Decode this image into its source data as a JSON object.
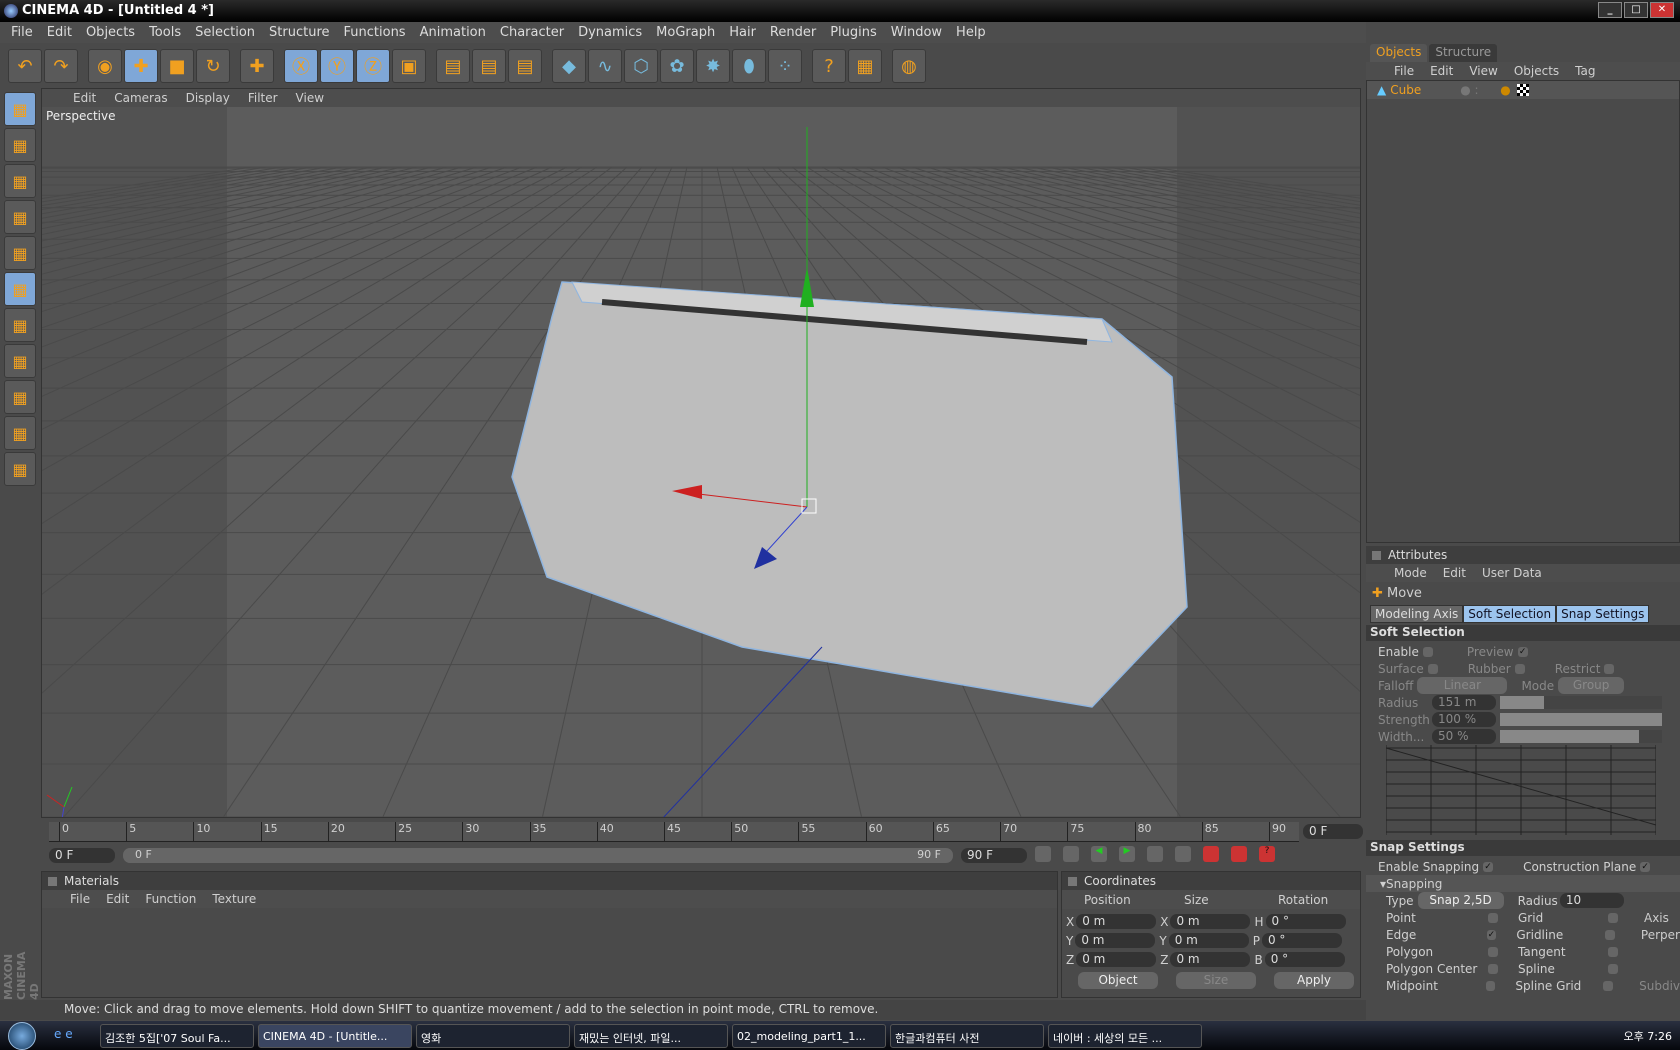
{
  "window": {
    "title": "CINEMA 4D - [Untitled 4 *]"
  },
  "menu": [
    "File",
    "Edit",
    "Objects",
    "Tools",
    "Selection",
    "Structure",
    "Functions",
    "Animation",
    "Character",
    "Dynamics",
    "MoGraph",
    "Hair",
    "Render",
    "Plugins",
    "Window",
    "Help"
  ],
  "toolbar": {
    "icons": [
      "undo-icon",
      "redo-icon",
      "live-selection-icon",
      "move-icon",
      "scale-icon",
      "rotate-icon",
      "add-icon",
      "x-axis-icon",
      "y-axis-icon",
      "z-axis-icon",
      "coordinate-system-icon",
      "render-view-icon",
      "render-picture-viewer-icon",
      "render-settings-icon",
      "cube-primitive-icon",
      "spline-icon",
      "nurbs-icon",
      "array-icon",
      "deformer-icon",
      "scene-icon",
      "particle-icon",
      "help-icon",
      "timeline-icon",
      "browser-icon"
    ]
  },
  "viewport": {
    "menu": [
      "Edit",
      "Cameras",
      "Display",
      "Filter",
      "View"
    ],
    "label": "Perspective"
  },
  "timeline": {
    "ticks": [
      "0",
      "5",
      "10",
      "15",
      "20",
      "25",
      "30",
      "35",
      "40",
      "45",
      "50",
      "55",
      "60",
      "65",
      "70",
      "75",
      "80",
      "85",
      "90"
    ],
    "current_frame": "0 F",
    "start": "0 F",
    "slider_start": "0 F",
    "slider_end": "90 F",
    "end": "90 F"
  },
  "materials": {
    "title": "Materials",
    "menu": [
      "File",
      "Edit",
      "Function",
      "Texture"
    ]
  },
  "coordinates": {
    "title": "Coordinates",
    "headers": [
      "Position",
      "Size",
      "Rotation"
    ],
    "rows": [
      {
        "a": "X",
        "p": "0 m",
        "s": "0 m",
        "r_label": "H",
        "r": "0 °"
      },
      {
        "a": "Y",
        "p": "0 m",
        "s": "0 m",
        "r_label": "P",
        "r": "0 °"
      },
      {
        "a": "Z",
        "p": "0 m",
        "s": "0 m",
        "r_label": "B",
        "r": "0 °"
      }
    ],
    "mode": "Object",
    "size_mode": "Size",
    "apply": "Apply"
  },
  "status": "Move: Click and drag to move elements. Hold down SHIFT to quantize movement / add to the selection in point mode, CTRL to remove.",
  "objects": {
    "tabs": [
      "Objects",
      "Structure"
    ],
    "menu": [
      "File",
      "Edit",
      "View",
      "Objects",
      "Tag"
    ],
    "items": [
      {
        "name": "Cube"
      }
    ]
  },
  "attributes": {
    "title": "Attributes",
    "menu": [
      "Mode",
      "Edit",
      "User Data"
    ],
    "tool": "Move",
    "tabs": [
      "Modeling Axis",
      "Soft Selection",
      "Snap Settings"
    ],
    "soft": {
      "title": "Soft Selection",
      "enable": "Enable",
      "preview": "Preview",
      "surface": "Surface",
      "rubber": "Rubber",
      "restrict": "Restrict",
      "falloff": "Falloff",
      "falloff_val": "Linear",
      "mode": "Mode",
      "mode_val": "Group",
      "radius": "Radius",
      "radius_val": "151 m",
      "strength": "Strength",
      "strength_val": "100 %",
      "width": "Width...",
      "width_val": "50 %",
      "strength_fill": 1.0,
      "width_fill": 0.86,
      "radius_fill": 0.27
    },
    "snap": {
      "title": "Snap Settings",
      "enable_snapping": "Enable Snapping",
      "construction_plane": "Construction Plane",
      "snapping": "Snapping",
      "type": "Type",
      "type_val": "Snap 2,5D",
      "radius": "Radius",
      "radius_val": "10",
      "col1": [
        {
          "l": "Point",
          "c": false
        },
        {
          "l": "Edge",
          "c": true
        },
        {
          "l": "Polygon",
          "c": false
        },
        {
          "l": "Polygon Center",
          "c": false
        },
        {
          "l": "Midpoint",
          "c": false
        }
      ],
      "col2": [
        {
          "l": "Grid",
          "c": false
        },
        {
          "l": "Gridline",
          "c": false
        },
        {
          "l": "Tangent",
          "c": false
        },
        {
          "l": "Spline",
          "c": false
        },
        {
          "l": "Spline Grid",
          "c": false
        }
      ],
      "col3": [
        "Axis",
        "Perper",
        "",
        "",
        "Subdiv"
      ]
    }
  },
  "taskbar": {
    "tasks": [
      "김조한 5집['07 Soul Fa...",
      "CINEMA 4D - [Untitle...",
      "영화",
      "재밌는 인터넷, 파일...",
      "02_modeling_part1_1...",
      "한글과컴퓨터 사전",
      "네이버 : 세상의 모든 ..."
    ],
    "clock": "오후 7:26"
  },
  "colors": {
    "accent": "#f0a020",
    "selection": "#7fa7d7",
    "x_axis": "#cc2020",
    "y_axis": "#20b020",
    "z_axis": "#2030a0"
  }
}
